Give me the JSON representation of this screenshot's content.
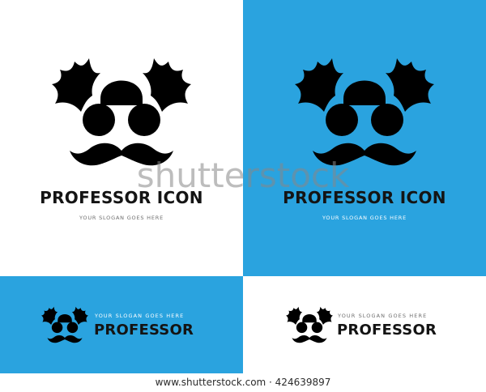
{
  "variants": [
    {
      "title": "PROFESSOR ICON",
      "slogan": "YOUR SLOGAN GOES HERE"
    },
    {
      "title": "PROFESSOR ICON",
      "slogan": "YOUR SLOGAN GOES HERE"
    },
    {
      "title": "PROFESSOR",
      "slogan": "YOUR SLOGAN GOES HERE"
    },
    {
      "title": "PROFESSOR",
      "slogan": "YOUR SLOGAN GOES HERE"
    }
  ],
  "watermark": "shutterstock",
  "footer": "www.shutterstock.com · 424639897",
  "colors": {
    "blue": "#2aa3df",
    "gray_hair": "#8c8c8c",
    "gray_mustache": "#6f6f6f",
    "glasses": "#141414",
    "white": "#ffffff"
  },
  "icon": "professor-face-icon"
}
